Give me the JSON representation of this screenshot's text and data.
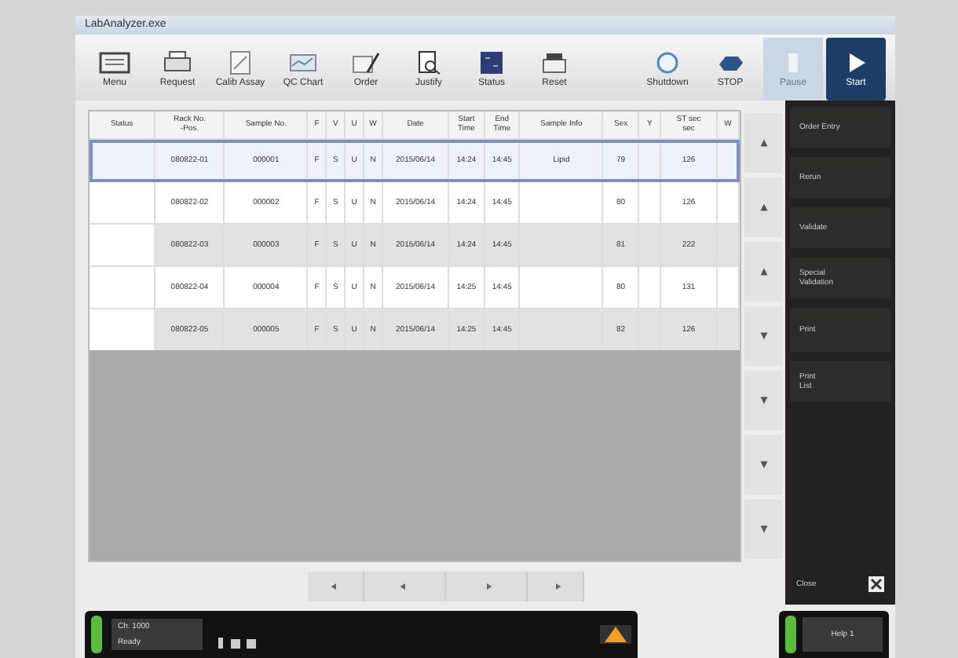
{
  "window": {
    "title": "LabAnalyzer.exe"
  },
  "toolbar": [
    {
      "label": "Menu",
      "kind": "grid"
    },
    {
      "label": "Request",
      "kind": "printer"
    },
    {
      "label": "Calib Assay",
      "kind": "doc"
    },
    {
      "label": "QC Chart",
      "kind": "chart"
    },
    {
      "label": "Order",
      "kind": "pen"
    },
    {
      "label": "Justify",
      "kind": "magnifier"
    },
    {
      "label": "Status",
      "kind": "status"
    },
    {
      "label": "Reset",
      "kind": "tray"
    }
  ],
  "toolbar_right": [
    {
      "label": "Shutdown",
      "kind": "power",
      "disabled": false
    },
    {
      "label": "STOP",
      "kind": "stop",
      "disabled": false
    },
    {
      "label": "Pause",
      "kind": "pause",
      "disabled": true
    },
    {
      "label": "Start",
      "kind": "start",
      "disabled": false
    }
  ],
  "table": {
    "columns": [
      "Status",
      "Rack No.\n-Pos.",
      "Sample No.",
      "F",
      "V",
      "U",
      "W",
      "Date",
      "Start\nTime",
      "End\nTime",
      "Sample Info",
      "Sex",
      "Y",
      "ST sec\nsec",
      "W"
    ],
    "rows": [
      {
        "selected": true,
        "cells": [
          "",
          "080822-01",
          "000001",
          "F",
          "S",
          "U",
          "N",
          "2015/06/14",
          "14:24",
          "14:45",
          "Lipid",
          "79",
          "",
          "126"
        ]
      },
      {
        "selected": false,
        "cells": [
          "",
          "080822-02",
          "000002",
          "F",
          "S",
          "U",
          "N",
          "2015/06/14",
          "14:24",
          "14:45",
          "",
          "80",
          "",
          "126"
        ]
      },
      {
        "selected": false,
        "cells": [
          "",
          "080822-03",
          "000003",
          "F",
          "S",
          "U",
          "N",
          "2015/06/14",
          "14:24",
          "14:45",
          "",
          "81",
          "",
          "222"
        ]
      },
      {
        "selected": false,
        "cells": [
          "",
          "080822-04",
          "000004",
          "F",
          "S",
          "U",
          "N",
          "2015/06/14",
          "14:25",
          "14:45",
          "",
          "80",
          "",
          "131"
        ]
      },
      {
        "selected": false,
        "cells": [
          "",
          "080822-05",
          "000005",
          "F",
          "S",
          "U",
          "N",
          "2015/06/14",
          "14:25",
          "14:45",
          "",
          "82",
          "",
          "126"
        ]
      }
    ]
  },
  "side_menu": [
    "Order Entry",
    "Rerun",
    "Validate",
    "Special\nValidation",
    "Print",
    "Print\nList"
  ],
  "close_label": "Close",
  "status": {
    "line1": "Ch. 1000",
    "line2": "Ready"
  },
  "right_status": "Help 1"
}
